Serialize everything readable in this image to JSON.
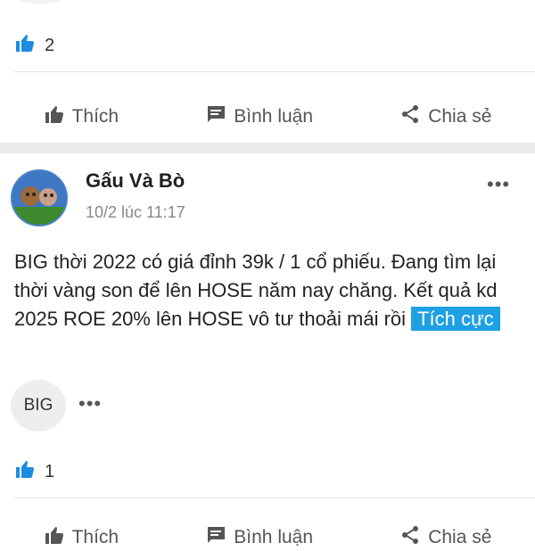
{
  "post1": {
    "like_count": "2",
    "actions": {
      "like": "Thích",
      "comment": "Bình luận",
      "share": "Chia sẻ"
    }
  },
  "post2": {
    "author": "Gấu Và Bò",
    "timestamp": "10/2 lúc 11:17",
    "more": "•••",
    "content": "BIG thời 2022 có giá đỉnh 39k / 1 cổ phiếu. Đang tìm lại thời vàng son để lên HOSE năm nay chăng. Kết quả kd 2025 ROE 20% lên HOSE vô tư thoải mái rồi",
    "sentiment_tag": "Tích cực",
    "ticker_chip": "BIG",
    "chip_more": "•••",
    "like_count": "1",
    "actions": {
      "like": "Thích",
      "comment": "Bình luận",
      "share": "Chia sẻ"
    }
  },
  "colors": {
    "accent": "#1da1e3",
    "like_blue": "#1b8de0",
    "separator": "#e9eaec"
  }
}
